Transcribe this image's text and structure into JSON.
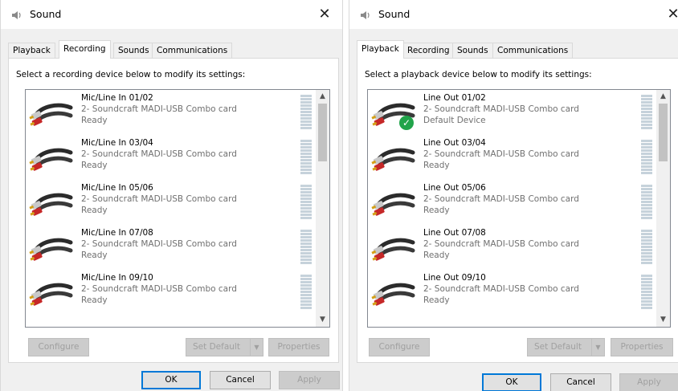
{
  "windows": [
    {
      "title": "Sound",
      "close_glyph": "✕",
      "tabs": [
        "Playback",
        "Recording",
        "Sounds",
        "Communications"
      ],
      "active_tab": "Recording",
      "instruction": "Select a recording device below to modify its settings:",
      "devices": [
        {
          "name": "Mic/Line In 01/02",
          "description": "2- Soundcraft MADI-USB Combo card",
          "status": "Ready"
        },
        {
          "name": "Mic/Line In 03/04",
          "description": "2- Soundcraft MADI-USB Combo card",
          "status": "Ready"
        },
        {
          "name": "Mic/Line In 05/06",
          "description": "2- Soundcraft MADI-USB Combo card",
          "status": "Ready"
        },
        {
          "name": "Mic/Line In 07/08",
          "description": "2- Soundcraft MADI-USB Combo card",
          "status": "Ready"
        },
        {
          "name": "Mic/Line In 09/10",
          "description": "2- Soundcraft MADI-USB Combo card",
          "status": "Ready"
        }
      ],
      "buttons": {
        "configure": "Configure",
        "set_default": "Set Default",
        "properties": "Properties",
        "ok": "OK",
        "cancel": "Cancel",
        "apply": "Apply"
      }
    },
    {
      "title": "Sound",
      "close_glyph": "✕",
      "tabs": [
        "Playback",
        "Recording",
        "Sounds",
        "Communications"
      ],
      "active_tab": "Playback",
      "instruction": "Select a playback device below to modify its settings:",
      "devices": [
        {
          "name": "Line Out 01/02",
          "description": "2- Soundcraft MADI-USB Combo card",
          "status": "Default Device",
          "is_default": true
        },
        {
          "name": "Line Out 03/04",
          "description": "2- Soundcraft MADI-USB Combo card",
          "status": "Ready"
        },
        {
          "name": "Line Out 05/06",
          "description": "2- Soundcraft MADI-USB Combo card",
          "status": "Ready"
        },
        {
          "name": "Line Out 07/08",
          "description": "2- Soundcraft MADI-USB Combo card",
          "status": "Ready"
        },
        {
          "name": "Line Out 09/10",
          "description": "2- Soundcraft MADI-USB Combo card",
          "status": "Ready"
        }
      ],
      "buttons": {
        "configure": "Configure",
        "set_default": "Set Default",
        "properties": "Properties",
        "ok": "OK",
        "cancel": "Cancel",
        "apply": "Apply"
      }
    }
  ],
  "colors": {
    "accent": "#0078d7",
    "default_check": "#21a44a",
    "meter": "#c6d2db"
  }
}
